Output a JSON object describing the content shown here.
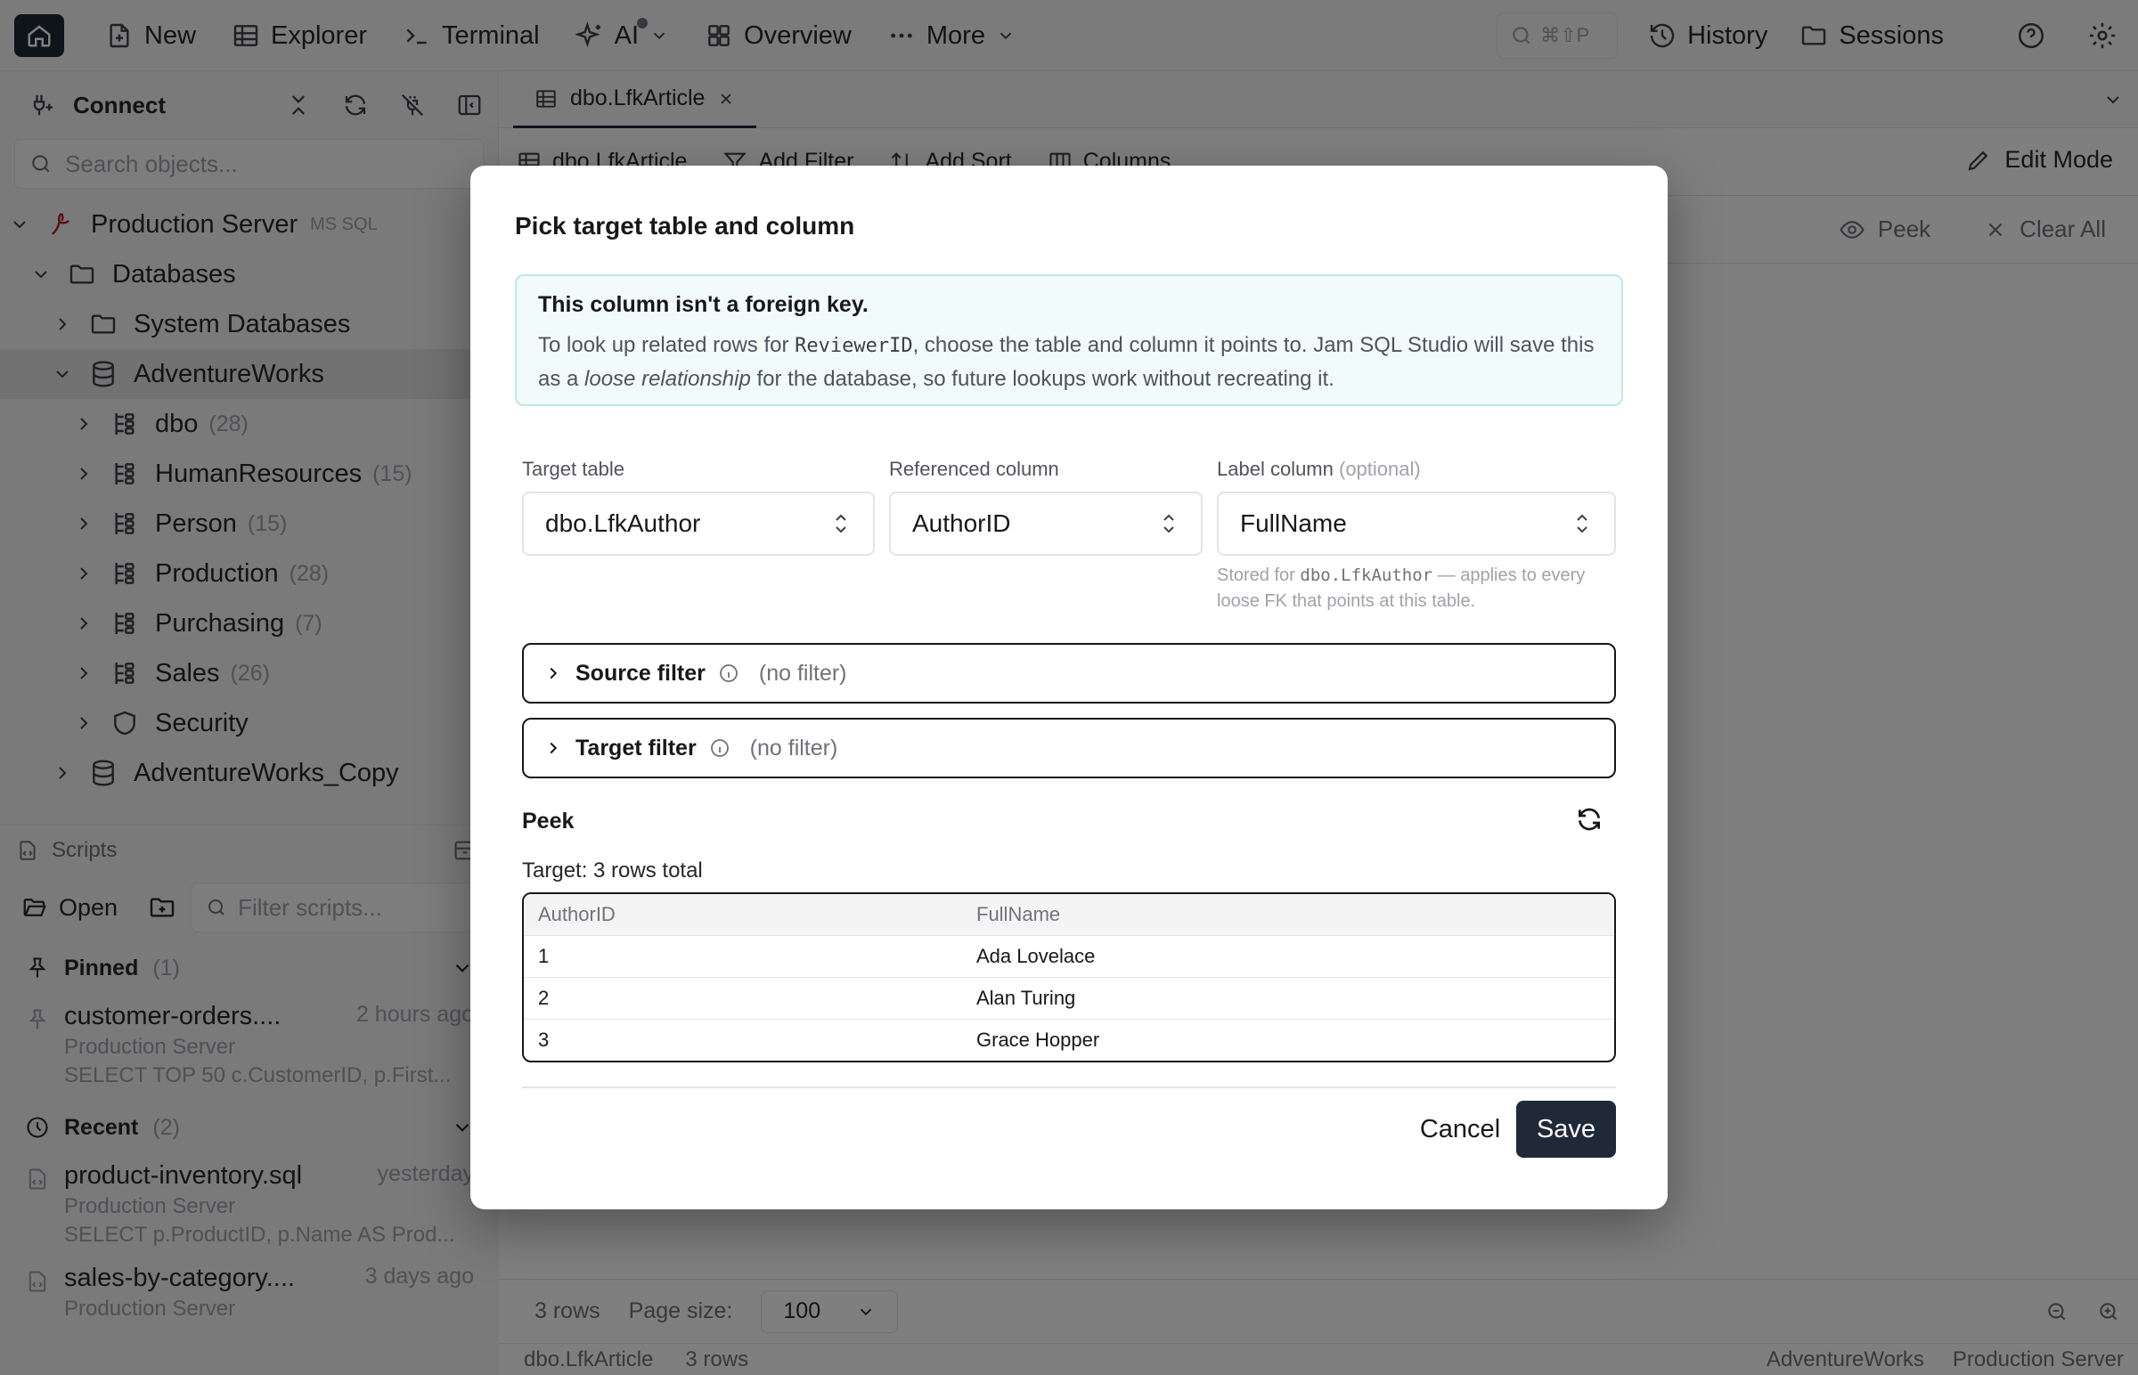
{
  "topnav": {
    "new": "New",
    "explorer": "Explorer",
    "terminal": "Terminal",
    "ai": "AI",
    "overview": "Overview",
    "more": "More"
  },
  "topright": {
    "search_shortcut": "⌘⇧P",
    "history": "History",
    "sessions": "Sessions"
  },
  "sidebar": {
    "title": "Connect",
    "search_placeholder": "Search objects...",
    "server": {
      "name": "Production Server",
      "tag": "MS SQL"
    },
    "databases_label": "Databases",
    "system_databases": "System Databases",
    "adventureworks": "AdventureWorks",
    "schemas": [
      {
        "name": "dbo",
        "count": "(28)"
      },
      {
        "name": "HumanResources",
        "count": "(15)"
      },
      {
        "name": "Person",
        "count": "(15)"
      },
      {
        "name": "Production",
        "count": "(28)"
      },
      {
        "name": "Purchasing",
        "count": "(7)"
      },
      {
        "name": "Sales",
        "count": "(26)"
      },
      {
        "name": "Security",
        "count": ""
      }
    ],
    "adventureworks_copy": "AdventureWorks_Copy"
  },
  "scripts": {
    "title": "Scripts",
    "open": "Open",
    "filter_placeholder": "Filter scripts...",
    "pinned_label": "Pinned",
    "pinned_count": "(1)",
    "recent_label": "Recent",
    "recent_count": "(2)",
    "pinned_items": [
      {
        "name": "customer-orders....",
        "time": "2 hours ago",
        "server": "Production Server",
        "preview": "SELECT TOP 50 c.CustomerID, p.First..."
      }
    ],
    "recent_items": [
      {
        "name": "product-inventory.sql",
        "time": "yesterday",
        "server": "Production Server",
        "preview": "SELECT p.ProductID, p.Name AS Prod..."
      },
      {
        "name": "sales-by-category....",
        "time": "3 days ago",
        "server": "Production Server",
        "preview": ""
      }
    ]
  },
  "main": {
    "tab_label": "dbo.LfkArticle",
    "toolbar": {
      "table": "dbo.LfkArticle",
      "add_filter": "Add Filter",
      "add_sort": "Add Sort",
      "columns": "Columns",
      "edit_mode": "Edit Mode"
    },
    "filterbar": {
      "peek": "Peek",
      "clear_all": "Clear All"
    },
    "status": {
      "rows": "3 rows",
      "page_size_label": "Page size:",
      "page_size_value": "100"
    },
    "footer": {
      "table": "dbo.LfkArticle",
      "rows": "3 rows",
      "database": "AdventureWorks",
      "server": "Production Server"
    }
  },
  "modal": {
    "title": "Pick target table and column",
    "note_heading": "This column isn't a foreign key.",
    "note_b1": "To look up related rows for ",
    "note_code": "ReviewerID",
    "note_b2": ", choose the table and column it points to. Jam SQL Studio will save this as a ",
    "note_em": "loose relationship",
    "note_b3": " for the database, so future lookups work without recreating it.",
    "target_table_label": "Target table",
    "target_table_value": "dbo.LfkAuthor",
    "ref_column_label": "Referenced column",
    "ref_column_value": "AuthorID",
    "label_column_label": "Label column",
    "label_column_optional": "(optional)",
    "label_column_value": "FullName",
    "hint_a": "Stored for ",
    "hint_code": "dbo.LfkAuthor",
    "hint_b": " — applies to every loose FK that points at this table.",
    "source_filter_label": "Source filter",
    "source_filter_value": "(no filter)",
    "target_filter_label": "Target filter",
    "target_filter_value": "(no filter)",
    "peek_label": "Peek",
    "peek_total": "Target: 3 rows total",
    "peek_columns": [
      "AuthorID",
      "FullName"
    ],
    "peek_rows": [
      [
        "1",
        "Ada Lovelace"
      ],
      [
        "2",
        "Alan Turing"
      ],
      [
        "3",
        "Grace Hopper"
      ]
    ],
    "cancel": "Cancel",
    "save": "Save"
  }
}
